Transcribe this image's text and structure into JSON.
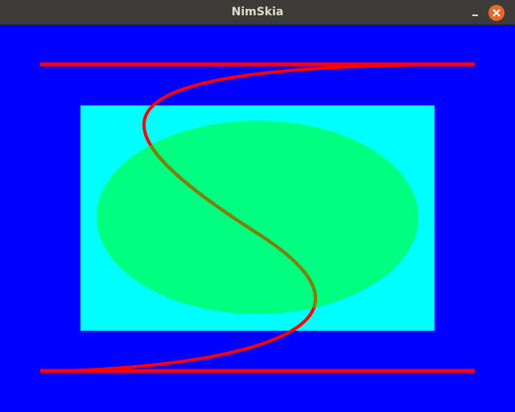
{
  "window": {
    "title": "NimSkia"
  },
  "icons": {
    "minimize": "minimize-icon",
    "close": "close-icon"
  },
  "colors": {
    "titlebar": "#3c3b37",
    "title_text": "#dfdbd2",
    "close_button": "#e9662c",
    "background": "#0000ff",
    "rectangle": "#00ffff",
    "ellipse": "#00ff80",
    "lines": "#ff0000",
    "curve": "#ff0000",
    "curve_over_ellipse": "#808000"
  }
}
